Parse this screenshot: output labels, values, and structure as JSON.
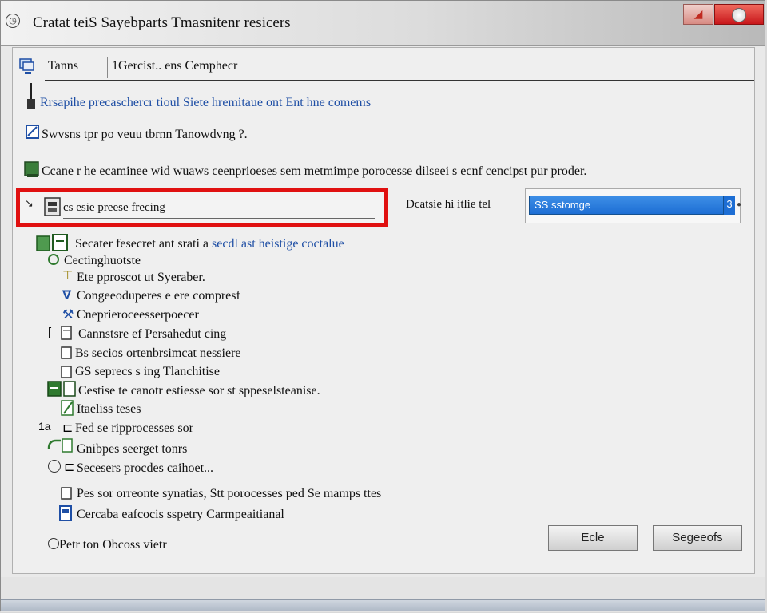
{
  "window": {
    "title": "Cratat teiS Sayebparts Tmasnitenr resicers"
  },
  "tabs": [
    {
      "label": "Tanns"
    },
    {
      "label": "1Gercist.. ens Cemphecr"
    }
  ],
  "lines": {
    "line1": "Rrsapihe precaschercr tioul Siete hremitaue ont Ent hne comems",
    "line2": "Swvsns tpr po veuu tbrnn Tanowdvng ?.",
    "line3": "Ccane r he ecaminee wid wuaws ceenprioeses sem metmimpe porocesse dilseei s ecnf cencipst pur proder."
  },
  "selected_field": {
    "value": "cs esie preese frecing"
  },
  "dropdown": {
    "label": "Dcatsie hi itlie tel",
    "selected": "SS sstomge",
    "count": "3"
  },
  "tree": {
    "header": "Secater fesecret ant srati a",
    "header_link": "secdl ast heistige coctalue",
    "items": [
      {
        "label": "Cectinghuotste"
      },
      {
        "label": "Ete pproscot ut Syeraber."
      },
      {
        "label": "Congeeoduperes e ere compresf"
      },
      {
        "label": "Cneprieroceesserpoecer"
      },
      {
        "label": "Cannstsre ef Persahedut cing"
      },
      {
        "label": "Bs secios ortenbrsimcat nessiere"
      },
      {
        "label": "GS seprecs s ing Tlanchitise"
      },
      {
        "label": "Cestise te canotr estiesse sor st sppeselsteanise."
      },
      {
        "label": "Itaeliss teses"
      },
      {
        "label": "Fed se ripprocesses sor"
      },
      {
        "label": "Gnibpes seerget tonrs"
      },
      {
        "label": "Secesers procdes caihoet..."
      },
      {
        "label": "Pes sor orreonte synatias, Stt porocesses ped Se mamps ttes"
      },
      {
        "label": "Cercaba eafcocis sspetry Carmpeaitianal"
      }
    ],
    "markers": {
      "arrow_mark": "↗",
      "bracket_mark": "[",
      "number_mark": "1a"
    }
  },
  "footer": {
    "radio_label": "Petr ton Obcoss vietr"
  },
  "buttons": {
    "primary": "Ecle",
    "secondary": "Segeeofs"
  },
  "colors": {
    "accent_red": "#e01010",
    "selection_blue": "#1d6ed4",
    "link_blue": "#1f4fa5"
  }
}
